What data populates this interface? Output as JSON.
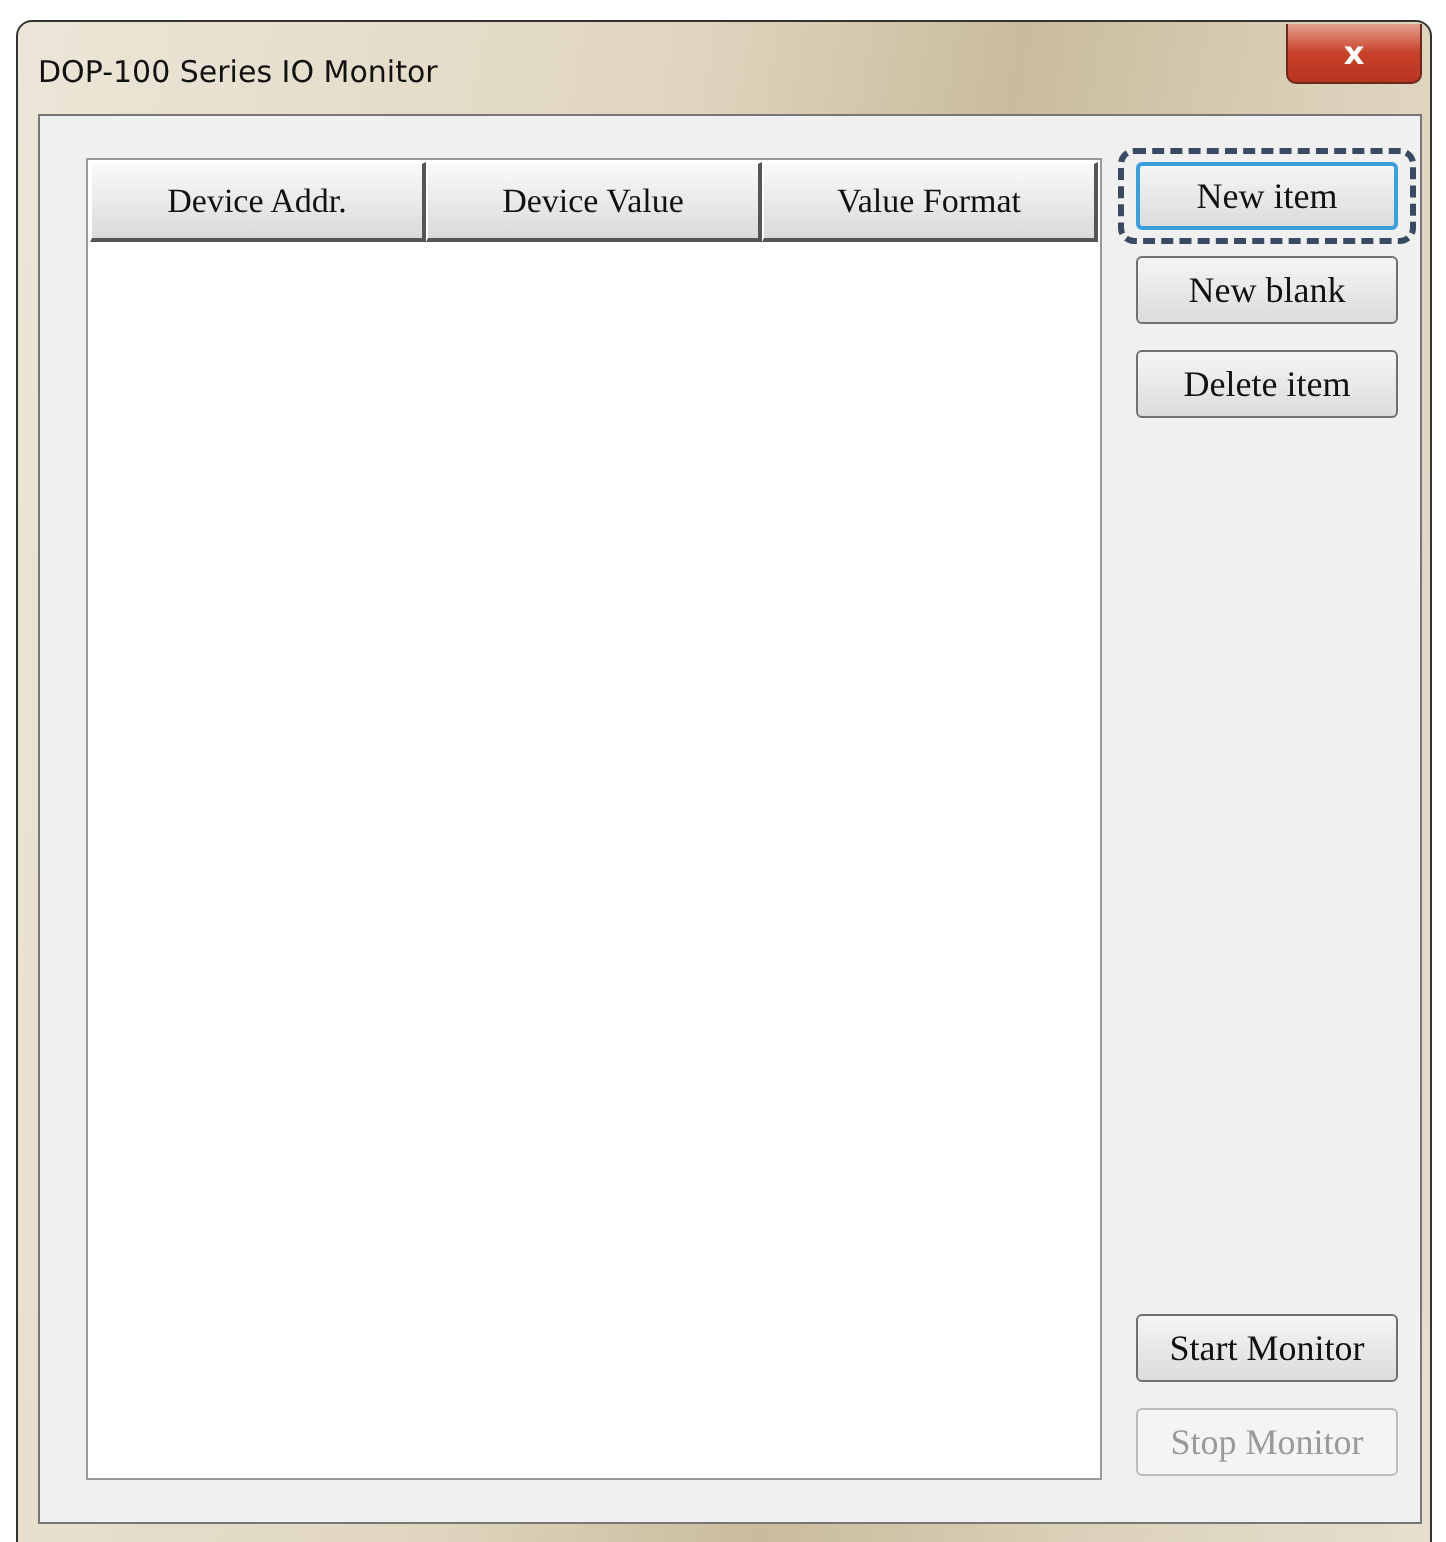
{
  "window": {
    "title": "DOP-100 Series IO Monitor",
    "close_label": "x"
  },
  "table": {
    "columns": [
      "Device Addr.",
      "Device Value",
      "Value Format"
    ]
  },
  "top_buttons": [
    {
      "label": "New item",
      "focused": true,
      "disabled": false
    },
    {
      "label": "New blank",
      "focused": false,
      "disabled": false
    },
    {
      "label": "Delete item",
      "focused": false,
      "disabled": false
    }
  ],
  "bottom_buttons": [
    {
      "label": "Start Monitor",
      "focused": false,
      "disabled": false
    },
    {
      "label": "Stop Monitor",
      "focused": false,
      "disabled": true
    }
  ]
}
